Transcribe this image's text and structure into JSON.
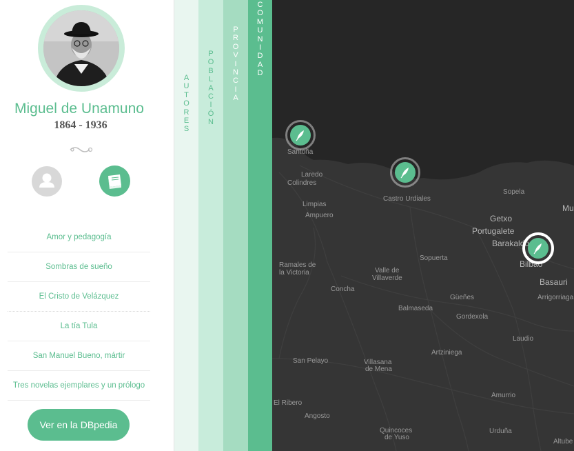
{
  "author": {
    "name": "Miguel de Unamuno",
    "years": "1864 - 1936"
  },
  "toggles": {
    "person_icon": "person-icon",
    "books_icon": "book-icon"
  },
  "works": [
    "Amor y pedagogía",
    "Sombras de sueño",
    "El Cristo de Velázquez",
    "La tía Tula",
    "San Manuel Bueno, mártir",
    "Tres novelas ejemplares y un prólogo"
  ],
  "dbpedia_button": "Ver en la DBpedia",
  "filters": {
    "autores": "AUTORES",
    "poblacion": "POBLACIÓN",
    "provincia": "PROVINCIA",
    "comunidad": "COMUNIDAD"
  },
  "map": {
    "places": {
      "santona": "Santoña",
      "laredo": "Laredo",
      "colindres": "Colindres",
      "castro": "Castro Urdiales",
      "limpias": "Limpias",
      "ampuero": "Ampuero",
      "sopela": "Sopela",
      "getxo": "Getxo",
      "portugalete": "Portugalete",
      "barakaldo": "Barakaldo",
      "mu": "Mu",
      "bilbao": "Bilbao",
      "basauri": "Basauri",
      "arrigorriaga": "Arrigorriaga",
      "sopuerta": "Sopuerta",
      "ramales1": "Ramales de",
      "ramales2": "la Victoria",
      "valle1": "Valle de",
      "valle2": "Villaverde",
      "concha": "Concha",
      "guenes": "Güeñes",
      "balmaseda": "Balmaseda",
      "gordexola": "Gordexola",
      "laudio": "Laudio",
      "artziniega": "Artziniega",
      "sanpelayo": "San Pelayo",
      "villasana1": "Villasana",
      "villasana2": "de Mena",
      "amurrio": "Amurrio",
      "elribero": "El Ribero",
      "angosto": "Angosto",
      "quincoces1": "Quincoces",
      "quincoces2": "de Yuso",
      "urduna": "Urduña",
      "altube": "Altube"
    },
    "marker_icon": "quill-icon"
  },
  "colors": {
    "accent": "#5bbd8f",
    "map_bg": "#2d2d2d"
  }
}
